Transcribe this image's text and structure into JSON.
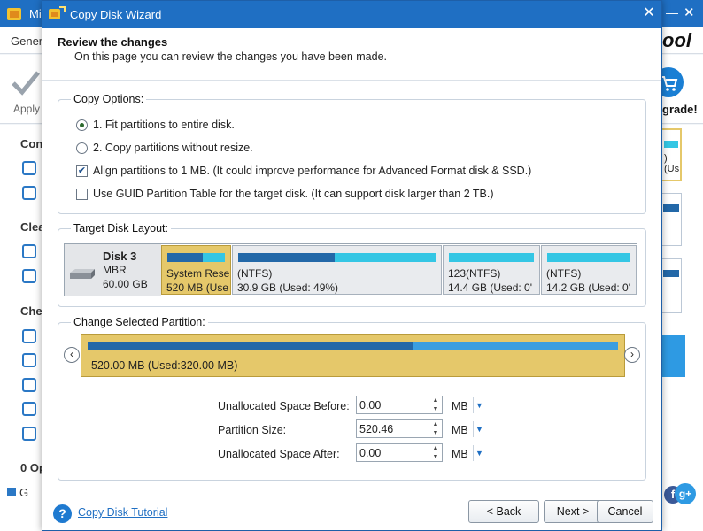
{
  "background_app": {
    "title": "Mi",
    "menu_general": "Gener",
    "apply_label": "Apply",
    "brand_fragment": "ool",
    "upgrade_label": "grade!",
    "sidebar_sections": [
      "Con",
      "Clea",
      "Che",
      "0 Op"
    ],
    "sidebar_bottom_label": "G",
    "right_panel_fragments": [
      ")",
      "(Us"
    ]
  },
  "dialog": {
    "title": "Copy Disk Wizard",
    "header_title": "Review the changes",
    "header_subtitle": "On this page you can review the changes you have been made."
  },
  "copy_options": {
    "legend": "Copy Options:",
    "fit_partitions": "1. Fit partitions to entire disk.",
    "copy_without_resize": "2. Copy partitions without resize.",
    "align_1mb": "Align partitions to 1 MB.  (It could improve performance for Advanced Format disk & SSD.)",
    "use_gpt": "Use GUID Partition Table for the target disk. (It can support disk larger than 2 TB.)",
    "fit_selected": true,
    "align_checked": true,
    "gpt_checked": false
  },
  "target_disk": {
    "legend": "Target Disk Layout:",
    "disk_name": "Disk 3",
    "disk_type": "MBR",
    "disk_size": "60.00 GB",
    "partitions": [
      {
        "label": "System Rese",
        "size": "520 MB (Use",
        "used_fraction": 0.62,
        "selected": true
      },
      {
        "label": "(NTFS)",
        "size": "30.9 GB (Used: 49%)",
        "used_fraction": 0.49,
        "selected": false
      },
      {
        "label": "123(NTFS)",
        "size": "14.4 GB (Used: 0'",
        "used_fraction": 0.0,
        "selected": false
      },
      {
        "label": "(NTFS)",
        "size": "14.2 GB (Used: 0'",
        "used_fraction": 0.0,
        "selected": false
      }
    ]
  },
  "change_partition": {
    "legend": "Change Selected Partition:",
    "summary": "520.00 MB (Used:320.00 MB)",
    "used_fraction": 0.615,
    "left_arrow": "‹",
    "right_arrow": "›",
    "unallocated_before_label": "Unallocated Space Before:",
    "unallocated_before_value": "0.00",
    "partition_size_label": "Partition Size:",
    "partition_size_value": "520.46",
    "unallocated_after_label": "Unallocated Space After:",
    "unallocated_after_value": "0.00",
    "unit": "MB"
  },
  "footer": {
    "help_icon": "?",
    "tutorial_link": "Copy Disk Tutorial",
    "back_button": "< Back",
    "next_button": "Next >",
    "cancel_button": "Cancel"
  },
  "colors": {
    "title_bar": "#1f6fc3",
    "selected_partition": "#e5c86a",
    "used_space": "#2368a8",
    "free_space": "#34c6e4"
  }
}
